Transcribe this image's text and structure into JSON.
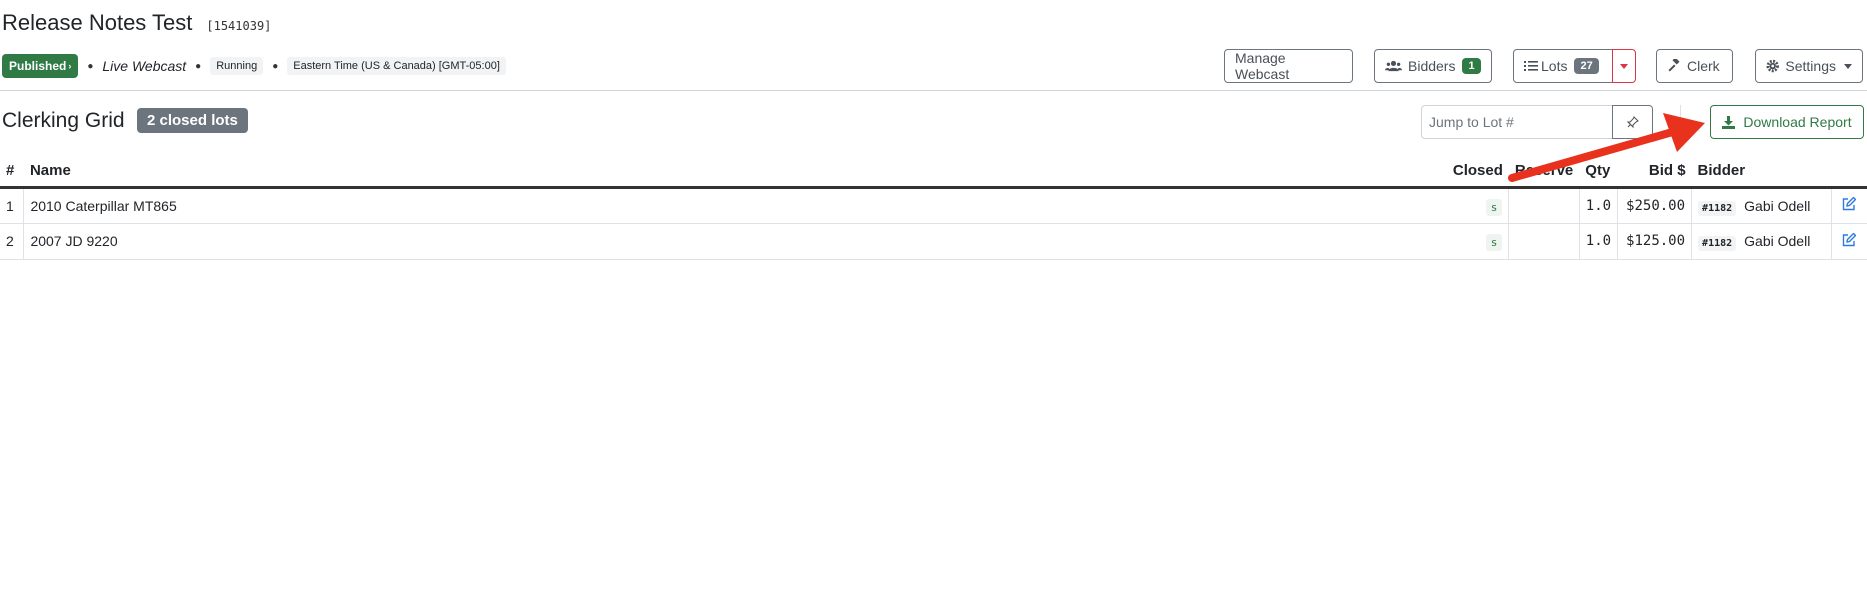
{
  "header": {
    "title": "Release Notes Test",
    "event_id": "[1541039]",
    "status_badge": "Published",
    "mode": "Live Webcast",
    "state": "Running",
    "timezone": "Eastern Time (US & Canada) [GMT-05:00]"
  },
  "toolbar": {
    "manage_webcast": "Manage Webcast",
    "bidders_label": "Bidders",
    "bidders_count": "1",
    "lots_label": "Lots",
    "lots_count": "27",
    "clerk_label": "Clerk",
    "settings_label": "Settings"
  },
  "section": {
    "title": "Clerking Grid",
    "closed_badge": "2 closed lots",
    "jump_placeholder": "Jump to Lot #",
    "download_label": "Download Report"
  },
  "table": {
    "headers": [
      "#",
      "Name",
      "Closed",
      "Reserve",
      "Qty",
      "Bid $",
      "Bidder"
    ],
    "rows": [
      {
        "num": "1",
        "name": "2010 Caterpillar MT865",
        "closed": "s",
        "reserve": "",
        "qty": "1.0",
        "bid": "$250.00",
        "bidder_num": "#1182",
        "bidder_name": "Gabi Odell"
      },
      {
        "num": "2",
        "name": "2007 JD 9220",
        "closed": "s",
        "reserve": "",
        "qty": "1.0",
        "bid": "$125.00",
        "bidder_num": "#1182",
        "bidder_name": "Gabi Odell"
      }
    ]
  },
  "colors": {
    "accent_green": "#2f7a45",
    "badge_grey": "#6c757d",
    "annotation_red": "#e8321e",
    "edit_blue": "#2d7be0"
  }
}
